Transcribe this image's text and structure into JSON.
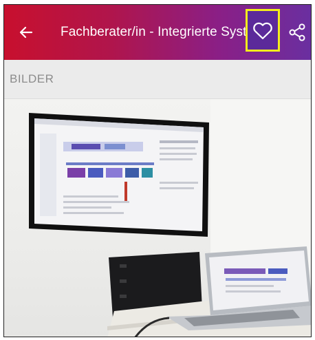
{
  "appbar": {
    "title": "Fachberater/in - Integrierte Syst...",
    "back_icon": "arrow-left-icon",
    "favorite_icon": "heart-outline-icon",
    "share_icon": "share-icon",
    "gradient_start": "#c8102e",
    "gradient_end": "#6a2fa0",
    "highlight_color": "#f2ee1c"
  },
  "section": {
    "label": "BILDER"
  },
  "gallery": {
    "image_subject": "wall-mounted monitor and laptop on a conference table"
  }
}
